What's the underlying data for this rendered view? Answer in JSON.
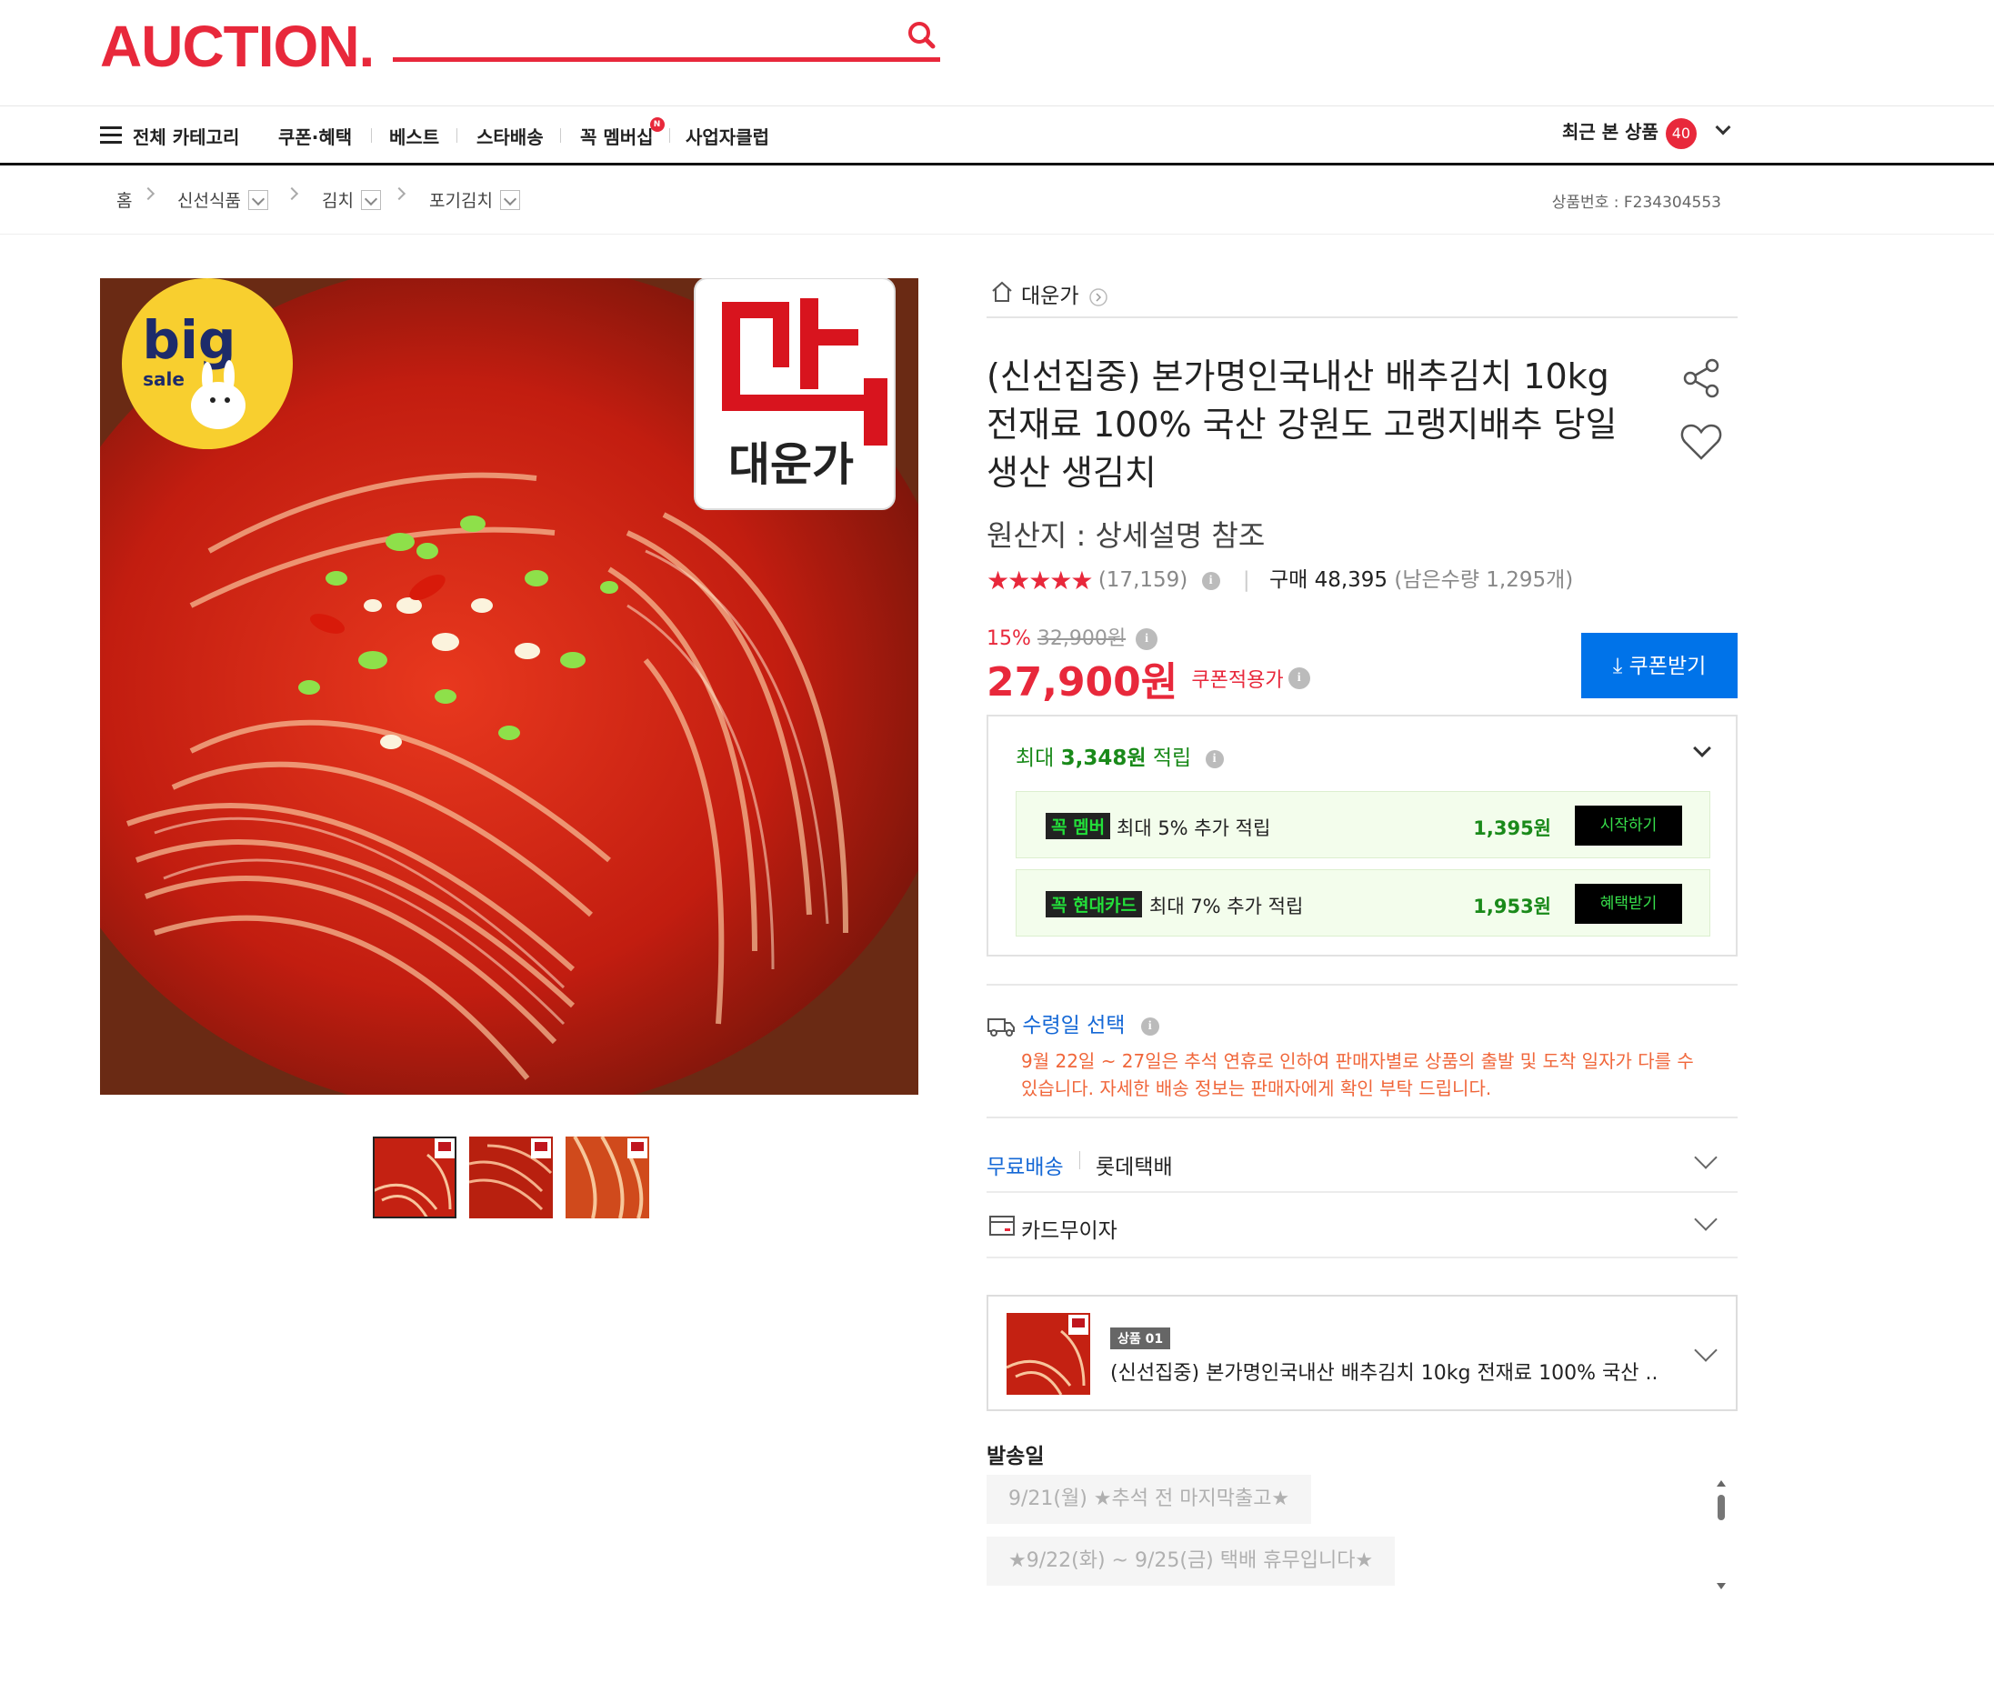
{
  "header": {
    "logo": "AUCTION.",
    "search_placeholder": ""
  },
  "nav": {
    "all_categories": "전체 카테고리",
    "items": [
      "쿠폰·혜택",
      "베스트",
      "스타배송",
      "꼭 멤버십",
      "사업자클럽"
    ],
    "membership_badge": "N",
    "recent_label": "최근 본 상품",
    "recent_count": "40"
  },
  "breadcrumb": {
    "home": "홈",
    "items": [
      "신선식품",
      "김치",
      "포기김치"
    ],
    "product_no": "상품번호 : F234304553"
  },
  "product": {
    "store": "대운가",
    "title": "(신선집중) 본가명인국내산 배추김치 10kg 전재료 100% 국산 강원도 고랭지배추 당일 생산 생김치",
    "origin": "원산지 : 상세설명 참조",
    "rating": 4.6,
    "stars": "★★★★★",
    "review_count": "(17,159)",
    "purchase": "구매 48,395",
    "stock": "(남은수량 1,295개)",
    "discount_rate": "15%",
    "original_price": "32,900원",
    "price": "27,900원",
    "coupon_applied": "쿠폰적용가",
    "coupon_button": "쿠폰받기"
  },
  "points": {
    "prefix": "최대 ",
    "amount": "3,348원",
    "suffix": " 적립",
    "benefits": [
      {
        "tag_a": "꼭",
        "tag_b": "멤버",
        "desc": "최대 5% 추가 적립",
        "amount": "1,395원",
        "button": "시작하기"
      },
      {
        "tag_a": "꼭",
        "tag_b": "현대카드",
        "desc": "최대 7% 추가 적립",
        "amount": "1,953원",
        "button": "혜택받기"
      }
    ]
  },
  "delivery": {
    "title": "수령일 선택",
    "note": "9월 22일 ~ 27일은 추석 연휴로 인하여 판매자별로 상품의 출발 및 도착 일자가 다를 수 있습니다. 자세한 배송 정보는 판매자에게 확인 부탁 드립니다.",
    "free_shipping": "무료배송",
    "carrier": "롯데택배",
    "card": "카드무이자"
  },
  "option": {
    "tag": "상품 01",
    "name": "(신선집중) 본가명인국내산 배추김치 10kg 전재료 100% 국산 ..."
  },
  "ship_date": {
    "label": "발송일",
    "options": [
      "9/21(월) ★추석 전 마지막출고★",
      "★9/22(화) ~ 9/25(금) 택배 휴무입니다★"
    ]
  },
  "image": {
    "brand_badge": "대운가",
    "sale_badge_top": "big",
    "sale_badge_bottom": "sale"
  },
  "colors": {
    "brand_red": "#e8283b",
    "blue": "#0073e9",
    "green": "#1a8a1a"
  }
}
